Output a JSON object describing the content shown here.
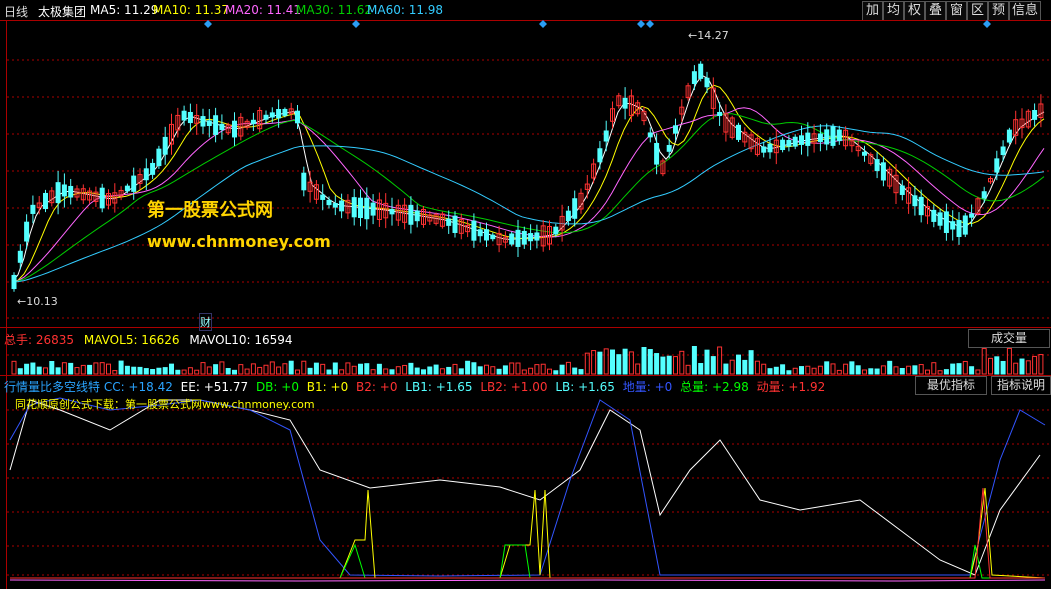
{
  "header": {
    "period": "日线",
    "stock_name": "太极集团",
    "ma": [
      {
        "label": "MA5: 11.29",
        "color": "#ffffff"
      },
      {
        "label": "MA10: 11.37",
        "color": "#ffff00"
      },
      {
        "label": "MA20: 11.41",
        "color": "#ff66ff"
      },
      {
        "label": "MA30: 11.62",
        "color": "#00cc00"
      },
      {
        "label": "MA60: 11.98",
        "color": "#33ccff"
      }
    ],
    "toolbar": [
      "加",
      "均",
      "权",
      "叠",
      "窗",
      "区",
      "预",
      "信息"
    ]
  },
  "price_chart": {
    "high_label": "14.27",
    "low_label": "10.13",
    "event_marker": "财",
    "watermark_cn": "第一股票公式网",
    "watermark_url": "www.chnmoney.com"
  },
  "volume_panel": {
    "total_label": "总手:",
    "total_value": "26835",
    "mavol5": "MAVOL5: 16626",
    "mavol10": "MAVOL10: 16594",
    "tab": "成交量"
  },
  "indicator_panel": {
    "name": "行情量比多空线特 CC: +18.42",
    "ee": "EE: +51.77",
    "db": "DB: +0",
    "b1": "B1: +0",
    "b2": "B2: +0",
    "lb1": "LB1: +1.65",
    "lb2": "LB2: +1.00",
    "lb": "LB: +1.65",
    "dl": "地量: +0",
    "zl": "总量: +2.98",
    "dongl": "动量: +1.92",
    "tab_best": "最优指标",
    "tab_desc": "指标说明",
    "note": "同花顺原创公式下载：第一股票公式网www.chnmoney.com"
  },
  "colors": {
    "up": "#ff3232",
    "down": "#54ffff",
    "grid": "#aa0000"
  }
}
